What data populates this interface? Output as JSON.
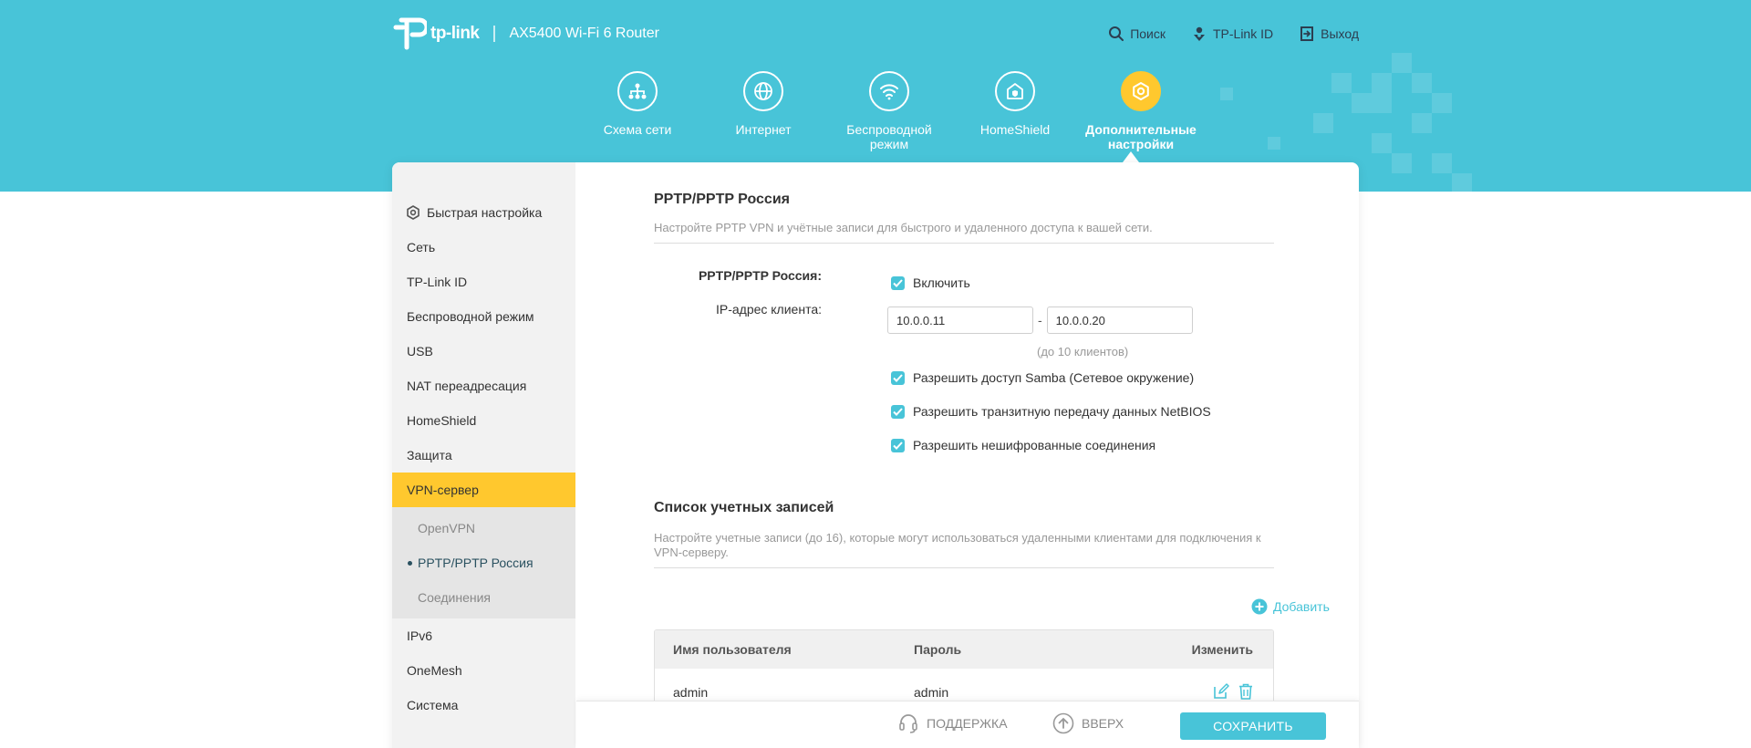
{
  "header": {
    "brand": "tp-link",
    "separator": "|",
    "model": "AX5400 Wi-Fi 6 Router",
    "top_links": [
      {
        "label": "Поиск",
        "icon": "search-icon"
      },
      {
        "label": "TP-Link ID",
        "icon": "user-icon"
      },
      {
        "label": "Выход",
        "icon": "logout-icon"
      }
    ],
    "main_nav": [
      {
        "label": "Схема сети",
        "icon": "network-map-icon",
        "active": false
      },
      {
        "label": "Интернет",
        "icon": "globe-icon",
        "active": false
      },
      {
        "label": "Беспроводной режим",
        "icon": "wifi-icon",
        "active": false
      },
      {
        "label": "HomeShield",
        "icon": "homeshield-icon",
        "active": false
      },
      {
        "label": "Дополнительные настройки",
        "icon": "gear-icon",
        "active": true
      }
    ]
  },
  "sidebar": {
    "items": [
      {
        "label": "Быстрая настройка",
        "icon": "quick-setup-icon"
      },
      {
        "label": "Сеть"
      },
      {
        "label": "TP-Link ID"
      },
      {
        "label": "Беспроводной режим"
      },
      {
        "label": "USB"
      },
      {
        "label": "NAT переадресация"
      },
      {
        "label": "HomeShield"
      },
      {
        "label": "Защита"
      },
      {
        "label": "VPN-сервер",
        "active": true
      },
      {
        "label": "IPv6"
      },
      {
        "label": "OneMesh"
      },
      {
        "label": "Система"
      }
    ],
    "vpn_subitems": [
      {
        "label": "OpenVPN"
      },
      {
        "label": "PPTP/PPTP Россия",
        "active": true
      },
      {
        "label": "Соединения"
      }
    ]
  },
  "pptp": {
    "title": "PPTP/PPTP Россия",
    "description": "Настройте PPTP VPN и учётные записи для быстрого и удаленного доступа к вашей сети.",
    "enable_label": "PPTP/PPTP Россия:",
    "enable_text": "Включить",
    "ip_label": "IP-адрес клиента:",
    "ip_start": "10.0.0.11",
    "ip_dash": "-",
    "ip_end": "10.0.0.20",
    "ip_hint": "(до 10 клиентов)",
    "options": [
      "Разрешить доступ Samba (Сетевое окружение)",
      "Разрешить транзитную передачу данных NetBIOS",
      "Разрешить нешифрованные соединения"
    ]
  },
  "accounts": {
    "title": "Список учетных записей",
    "description": "Настройте учетные записи (до 16), которые могут использоваться удаленными клиентами для подключения к VPN-серверу.",
    "add_label": "Добавить",
    "columns": [
      "Имя пользователя",
      "Пароль",
      "Изменить"
    ],
    "rows": [
      {
        "username": "admin",
        "password": "admin"
      }
    ]
  },
  "footer": {
    "support": "ПОДДЕРЖКА",
    "up": "ВВЕРХ",
    "save": "СОХРАНИТЬ"
  },
  "colors": {
    "brand_teal": "#48c4d8",
    "accent_yellow": "#ffc82e"
  }
}
